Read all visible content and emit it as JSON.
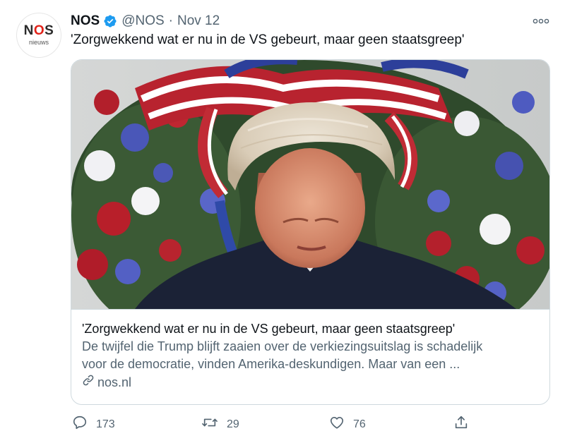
{
  "account": {
    "avatar_logo": [
      "N",
      "O",
      "S"
    ],
    "avatar_sub": "nieuws",
    "name": "NOS",
    "handle": "@NOS",
    "separator": "·",
    "date": "Nov 12"
  },
  "tweet": {
    "text": "'Zorgwekkend wat er nu in de VS gebeurt, maar geen staatsgreep'"
  },
  "card": {
    "title": "'Zorgwekkend wat er nu in de VS gebeurt, maar geen staatsgreep'",
    "description_line1": "De twijfel die Trump blijft zaaien over de verkiezingsuitslag is schadelijk",
    "description_line2": "voor de democratie, vinden Amerika-deskundigen. Maar van een ...",
    "domain": "nos.nl"
  },
  "actions": {
    "reply_count": "173",
    "retweet_count": "29",
    "like_count": "76"
  },
  "colors": {
    "verified": "#1d9bf0",
    "secondary_text": "#536471",
    "border": "#cfd9de",
    "nos_red": "#e2231a"
  }
}
